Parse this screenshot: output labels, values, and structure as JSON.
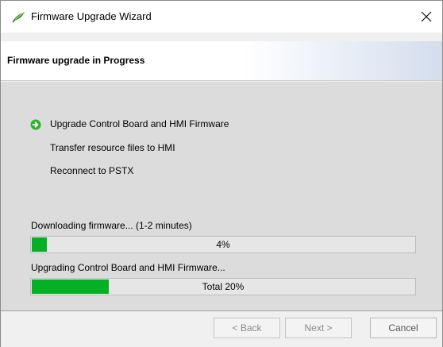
{
  "window": {
    "title": "Firmware Upgrade Wizard",
    "icon": "firmware-leaf-icon",
    "close_icon": "close-icon"
  },
  "header": {
    "title": "Firmware upgrade in Progress"
  },
  "steps": [
    {
      "label": "Upgrade Control Board and HMI Firmware",
      "active": true,
      "icon": "arrow-right-circle-icon"
    },
    {
      "label": "Transfer resource files to HMI",
      "active": false
    },
    {
      "label": "Reconnect to PSTX",
      "active": false
    }
  ],
  "progress": {
    "download_status": "Downloading firmware... (1-2 minutes)",
    "download_label": "4%",
    "download_fraction": 0.04,
    "upgrade_status": "Upgrading Control Board and HMI Firmware...",
    "total_label": "Total 20%",
    "total_fraction": 0.2,
    "fill_color": "#06b025"
  },
  "buttons": {
    "back": "< Back",
    "next": "Next >",
    "cancel": "Cancel"
  },
  "colors": {
    "accent_green": "#06b025",
    "step_icon_green": "#2bb52b"
  }
}
